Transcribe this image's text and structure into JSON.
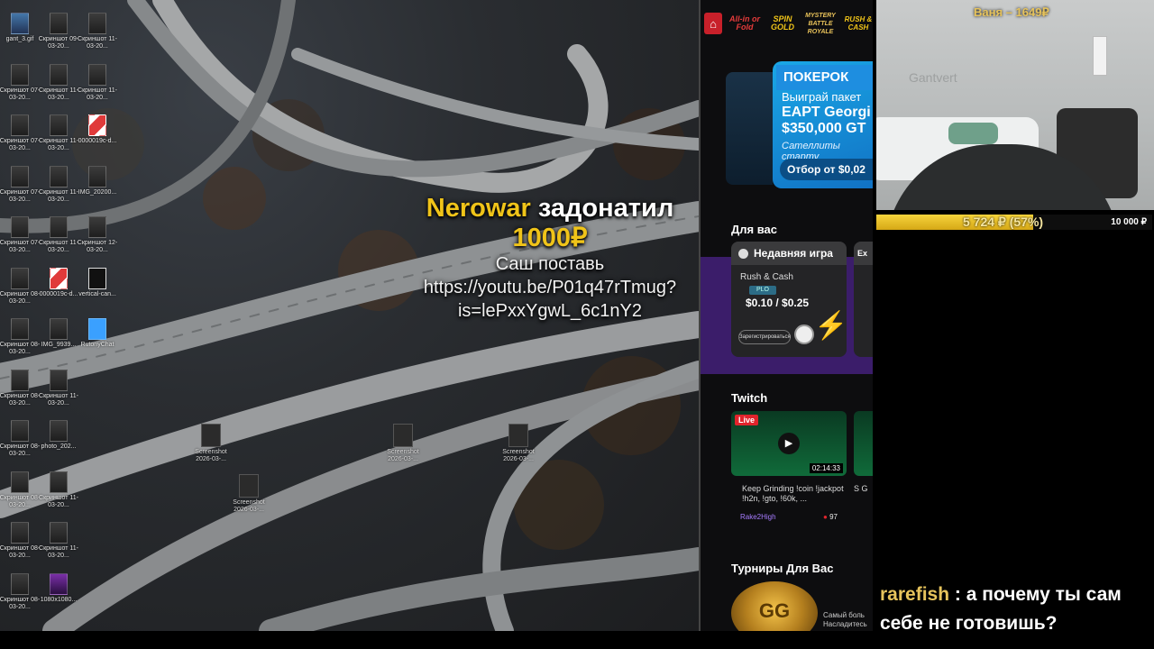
{
  "desktop": {
    "icons": [
      {
        "label": "gant_3.gif",
        "style": "gif"
      },
      {
        "label": "Скриншот 09-03-20...",
        "style": "plain"
      },
      {
        "label": "Скриншот 11-03-20...",
        "style": "plain"
      },
      {
        "label": "Скриншот 07-03-20...",
        "style": "plain"
      },
      {
        "label": "Скриншот 11-03-20...",
        "style": "plain"
      },
      {
        "label": "Скриншот 11-03-20...",
        "style": "plain"
      },
      {
        "label": "Скриншот 07-03-20...",
        "style": "plain"
      },
      {
        "label": "Скриншот 11-03-20...",
        "style": "plain"
      },
      {
        "label": "0000019c-d...",
        "style": "red"
      },
      {
        "label": "Скриншот 07-03-20...",
        "style": "plain"
      },
      {
        "label": "Скриншот 11-03-20...",
        "style": "plain"
      },
      {
        "label": "IMG_20200...",
        "style": "plain"
      },
      {
        "label": "Скриншот 07-03-20...",
        "style": "plain"
      },
      {
        "label": "Скриншот 11-03-20...",
        "style": "plain"
      },
      {
        "label": "Скриншот 12-03-20...",
        "style": "plain"
      },
      {
        "label": "Скриншот 08-03-20...",
        "style": "plain"
      },
      {
        "label": "0000019c-d...",
        "style": "red"
      },
      {
        "label": "vertical-can...",
        "style": "dark"
      },
      {
        "label": "Скриншот 08-03-20...",
        "style": "plain"
      },
      {
        "label": "IMG_9939...",
        "style": "plain"
      },
      {
        "label": "RutonyChat",
        "style": "chat"
      },
      {
        "label": "Скриншот 08-03-20...",
        "style": "plain"
      },
      {
        "label": "Скриншот 11-03-20...",
        "style": "plain"
      },
      {
        "label": "Скриншот 08-03-20...",
        "style": "plain"
      },
      {
        "label": "photo_202...",
        "style": "plain"
      },
      {
        "label": "Скриншот 08-03-20...",
        "style": "plain"
      },
      {
        "label": "Скриншот 11-03-20...",
        "style": "plain"
      },
      {
        "label": "Скриншот 08-03-20...",
        "style": "plain"
      },
      {
        "label": "Скриншот 11-03-20...",
        "style": "plain"
      },
      {
        "label": "Скриншот 08-03-20...",
        "style": "plain"
      },
      {
        "label": "1080x1080...",
        "style": "purple"
      }
    ],
    "screenshots": [
      {
        "label": "Screenshot 2026-03-..."
      },
      {
        "label": "Screenshot 2026-03-..."
      },
      {
        "label": "Screenshot 2026-03-..."
      },
      {
        "label": "Screenshot 2026-03-..."
      }
    ]
  },
  "donation": {
    "name": "Nerowar",
    "action": "задонатил",
    "amount": "1000₽",
    "message_line1": "Саш поставь",
    "message_line2": "https://youtu.be/P01q47rTmug?",
    "message_line3": "is=lePxxYgwL_6c1nY2"
  },
  "poker": {
    "top_logos": [
      "All-in or Fold",
      "SPIN GOLD",
      "MYSTERY BATTLE ROYALE",
      "RUSH & CASH"
    ],
    "promo": {
      "badge": "ПОКЕРОК",
      "line1": "Выиграй пакет",
      "line2": "EAPT Georgi",
      "line3": "$350,000 GT",
      "line4": "Сателлиты старту",
      "button": "Отбор от $0,02"
    },
    "for_you_title": "Для вас",
    "recent_game": {
      "header": "Недавняя игра",
      "game": "Rush & Cash",
      "type": "PLO",
      "stakes": "$0.10 / $0.25",
      "register": "Зарегистрироваться"
    },
    "second_card_header": "Ex",
    "twitch_title": "Twitch",
    "stream": {
      "live": "Live",
      "duration": "02:14:33",
      "title": "Keep Grinding !coin !jackpot !h2n, !gto, !60k, ...",
      "channel": "Rake2High",
      "viewers": "97"
    },
    "stream2_title": "S G",
    "tournaments_title": "Турниры Для Вас",
    "tournament_logo": "GG",
    "tournament_text_line1": "Самый боль",
    "tournament_text_line2": "Насладитесь"
  },
  "webcam": {
    "overlay_name": "Ваня – 1649₽",
    "wall_text": "Gantvert"
  },
  "goal": {
    "current": "5 724 ₽ (57%)",
    "target": "10 000 ₽",
    "progress": 0.57,
    "color": "#f0c419"
  },
  "chat": {
    "messages": [
      {
        "user": "rarefish",
        "separator": " : ",
        "text": "а почему ты сам себе не готовишь?"
      }
    ]
  }
}
